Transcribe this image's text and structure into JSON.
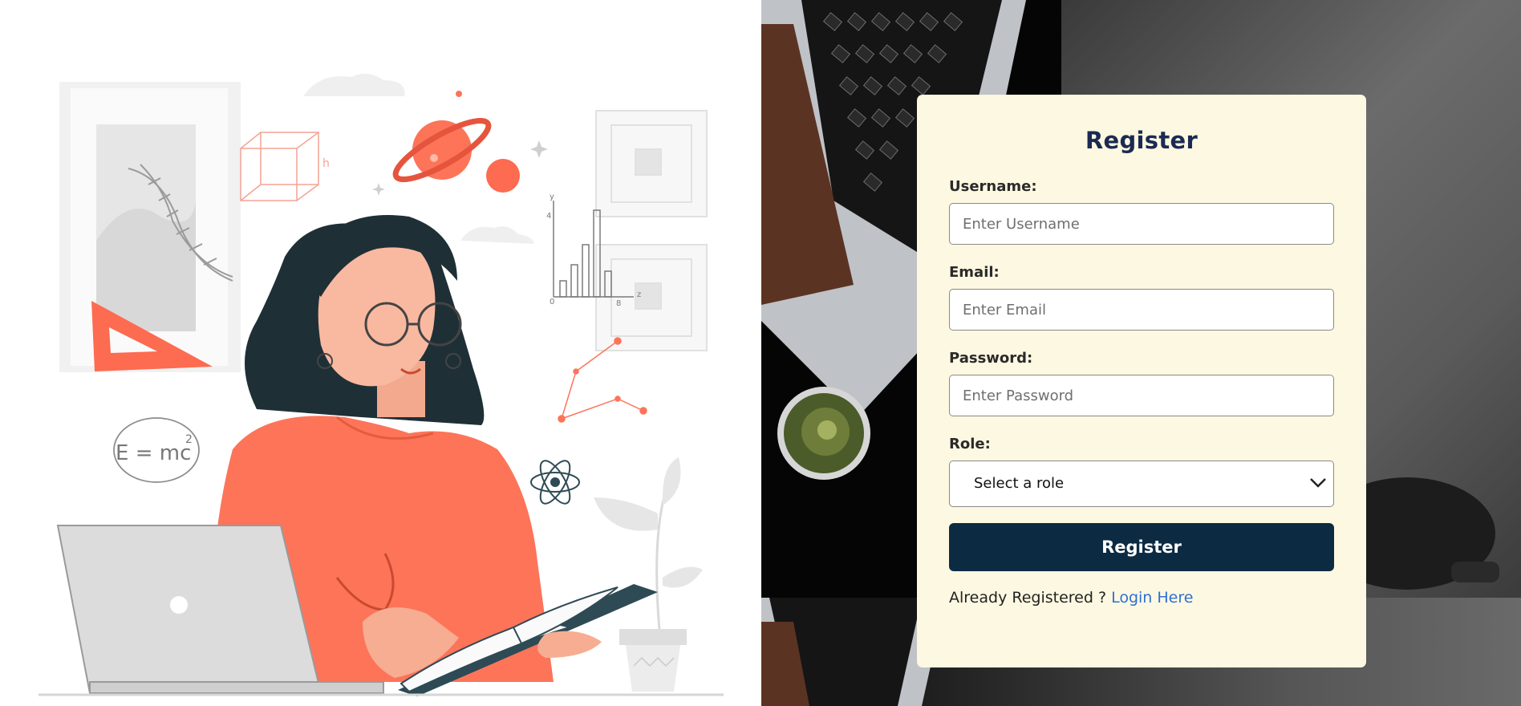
{
  "form": {
    "title": "Register",
    "username": {
      "label": "Username:",
      "placeholder": "Enter Username"
    },
    "email": {
      "label": "Email:",
      "placeholder": "Enter Email"
    },
    "password": {
      "label": "Password:",
      "placeholder": "Enter Password"
    },
    "role": {
      "label": "Role:",
      "selected": "Select a role"
    },
    "submit_label": "Register",
    "login_prompt": "Already Registered ? ",
    "login_link": "Login Here"
  },
  "illustration": {
    "formula_text": "E = mc",
    "formula_sup": "2",
    "cube_label": "h",
    "chart_x0": "0",
    "chart_x8": "8",
    "chart_xz": "z",
    "chart_y": "y",
    "chart_y4": "4"
  },
  "colors": {
    "accent": "#0c2b43",
    "title": "#1b2a52",
    "card": "#fdf8e1",
    "link": "#2f6fd6",
    "illustration_coral": "#fd7459",
    "hair": "#1f2f36"
  }
}
